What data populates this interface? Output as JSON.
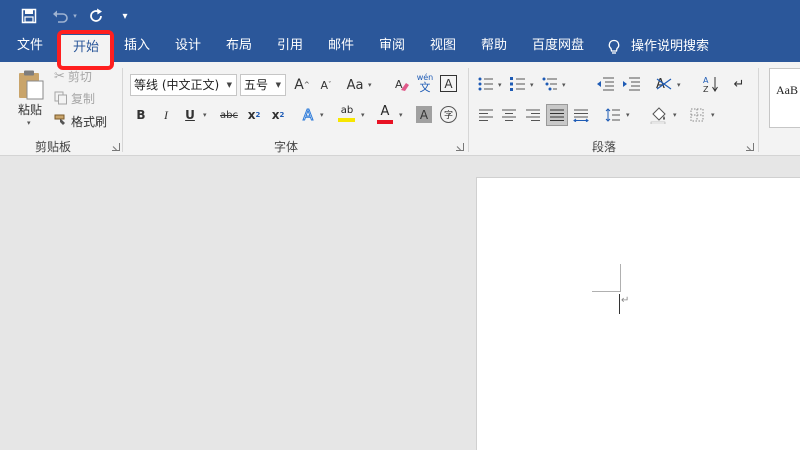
{
  "quick_access": {
    "customize_glyph": "▾"
  },
  "tabs": [
    "文件",
    "开始",
    "插入",
    "设计",
    "布局",
    "引用",
    "邮件",
    "审阅",
    "视图",
    "帮助",
    "百度网盘"
  ],
  "tell_me": "操作说明搜索",
  "clipboard": {
    "paste": "粘贴",
    "cut": "剪切",
    "copy": "复制",
    "format_painter": "格式刷",
    "group_label": "剪贴板"
  },
  "font": {
    "font_name": "等线 (中文正文)",
    "font_size": "五号",
    "grow": "A",
    "shrink": "A",
    "change_case": "Aa",
    "phonetic_top": "wén",
    "phonetic_bottom": "文",
    "char_border": "A",
    "bold": "B",
    "italic": "I",
    "underline": "U",
    "strikethrough": "abc",
    "subscript": "x",
    "superscript": "x",
    "text_effects": "A",
    "highlight": "ab",
    "font_color": "A",
    "char_shading": "A",
    "enclose": "字",
    "group_label": "字体"
  },
  "paragraph": {
    "group_label": "段落"
  },
  "styles": {
    "preview": "AaB"
  },
  "colors": {
    "title_bar": "#2b579a",
    "ribbon": "#f3f3f3",
    "highlight_box": "#ff1f1f",
    "font_color": "#e81123",
    "highlight_color": "#f7e600"
  }
}
